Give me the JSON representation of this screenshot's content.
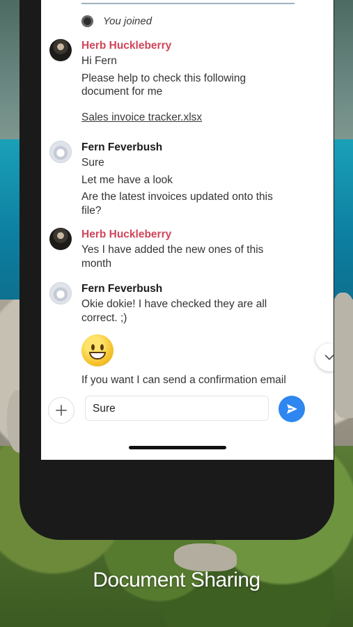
{
  "chat": {
    "joined_text": "You joined",
    "messages": [
      {
        "sender": "Herb Huckleberry",
        "sender_color": "#d0455a",
        "lines": [
          "Hi Fern",
          "Please help to check this following document for me"
        ],
        "attachment": "Sales invoice tracker.xlsx"
      },
      {
        "sender": "Fern Feverbush",
        "sender_color": "#1b1b1b",
        "lines": [
          "Sure",
          "Let me have a look",
          "Are the latest invoices updated onto this file?"
        ]
      },
      {
        "sender": "Herb Huckleberry",
        "sender_color": "#d0455a",
        "lines": [
          "Yes I have added the new ones of this month"
        ]
      },
      {
        "sender": "Fern Feverbush",
        "sender_color": "#1b1b1b",
        "lines": [
          "Okie dokie! I have checked they are all correct. ;)",
          "If you want I can send a confirmation email"
        ],
        "emoji": "grinning-face"
      }
    ]
  },
  "composer": {
    "input_value": "Sure",
    "plus_icon": "plus-icon",
    "send_icon": "send-icon",
    "send_color": "#2e86f0"
  },
  "scroll_down_icon": "chevron-down-icon",
  "caption": "Document Sharing"
}
